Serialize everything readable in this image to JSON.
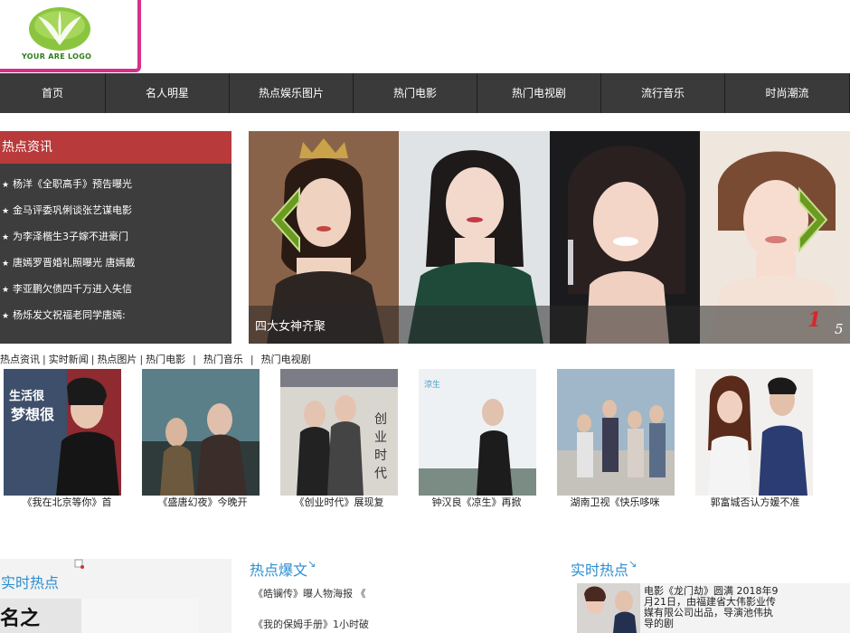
{
  "logo": {
    "text": "YOUR ARE LOGO",
    "border_color": "#d6308a",
    "leaf_color": "#8bc53f"
  },
  "nav": {
    "items": [
      "首页",
      "名人明星",
      "热点娱乐图片",
      "热门电影",
      "热门电视剧",
      "流行音乐",
      "时尚潮流"
    ]
  },
  "hot_news": {
    "title": "热点资讯",
    "items": [
      "杨洋《全职高手》预告曝光",
      "金马评委巩俐谈张艺谋电影",
      "为李泽楷生3子嫁不进豪门",
      "唐嫣罗晋婚礼照曝光 唐嫣戴",
      "李亚鹏欠债四千万进入失信",
      "杨烁发文祝福老同学唐嫣:"
    ]
  },
  "slider": {
    "caption": "四大女神齐聚",
    "active_index": "1",
    "total": "5",
    "arrow_left": "chevron-left",
    "arrow_right": "chevron-right"
  },
  "tabs": [
    {
      "label": "热点资讯",
      "sep": "|"
    },
    {
      "label": "实时新闻",
      "sep": "|"
    },
    {
      "label": "热点图片",
      "sep": "|"
    },
    {
      "label": "热门电影",
      "sep": "|"
    },
    {
      "label": "热门音乐",
      "sep": "|"
    },
    {
      "label": "热门电视剧",
      "sep": ""
    }
  ],
  "thumbnails": [
    {
      "caption": "《我在北京等你》首",
      "poster_text": "生活很梦想很"
    },
    {
      "caption": "《盛唐幻夜》今晚开",
      "poster_text": ""
    },
    {
      "caption": "《创业时代》展现复",
      "poster_text": "创业时代"
    },
    {
      "caption": "钟汉良《凉生》再掀",
      "poster_text": ""
    },
    {
      "caption": "湖南卫视《快乐哆咪",
      "poster_text": ""
    },
    {
      "caption": "郭富城否认方媛不准",
      "poster_text": ""
    }
  ],
  "bottom": {
    "live_hot_left": {
      "title": "实时热点",
      "img_text": "名之"
    },
    "hot_posts": {
      "title": "热点爆文",
      "corner": "↘",
      "items": [
        "《皓镧传》曝人物海报 《",
        "《我的保姆手册》1小时破"
      ]
    },
    "live_hot_right": {
      "title": "实时热点",
      "corner": "↘",
      "text": "电影《龙门劫》圆满 2018年9月21日，由福建省大伟影业传媒有限公司出品，导演池伟执导的剧"
    }
  }
}
